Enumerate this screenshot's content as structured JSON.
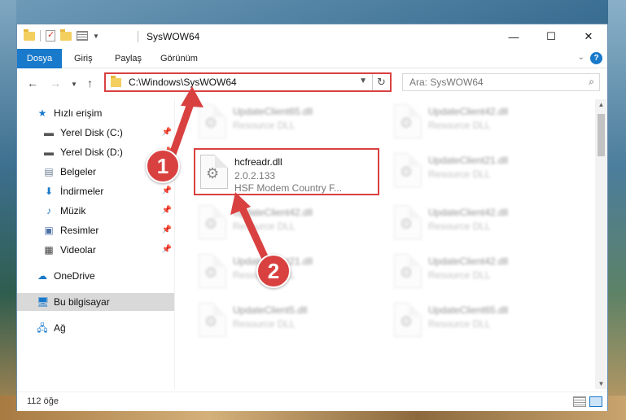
{
  "window": {
    "title": "SysWOW64",
    "buttons": {
      "minimize": "—",
      "maximize": "☐",
      "close": "✕"
    }
  },
  "ribbon": {
    "tabs": [
      "Dosya",
      "Giriş",
      "Paylaş",
      "Görünüm"
    ],
    "help": "?"
  },
  "nav": {
    "address": "C:\\Windows\\SysWOW64",
    "search_placeholder": "Ara: SysWOW64"
  },
  "sidebar": {
    "items": [
      {
        "label": "Hızlı erişim",
        "icon": "star-icon",
        "pinned": false
      },
      {
        "label": "Yerel Disk (C:)",
        "icon": "drive-icon",
        "pinned": true
      },
      {
        "label": "Yerel Disk (D:)",
        "icon": "drive-icon",
        "pinned": true
      },
      {
        "label": "Belgeler",
        "icon": "documents-icon",
        "pinned": true
      },
      {
        "label": "İndirmeler",
        "icon": "download-icon",
        "pinned": true
      },
      {
        "label": "Müzik",
        "icon": "music-icon",
        "pinned": true
      },
      {
        "label": "Resimler",
        "icon": "pictures-icon",
        "pinned": true
      },
      {
        "label": "Videolar",
        "icon": "video-icon",
        "pinned": true
      },
      {
        "label": "OneDrive",
        "icon": "cloud-icon",
        "pinned": false
      },
      {
        "label": "Bu bilgisayar",
        "icon": "computer-icon",
        "pinned": false
      },
      {
        "label": "Ağ",
        "icon": "network-icon",
        "pinned": false
      }
    ]
  },
  "files": {
    "highlighted": {
      "name": "hcfreadr.dll",
      "version": "2.0.2.133",
      "description": "HSF Modem Country F..."
    },
    "left_column": [
      {
        "name": "UpdateClient65.dll",
        "desc": "Resource DLL"
      },
      {
        "name": "UpdateClient42.dll",
        "desc": "Resource DLL"
      },
      {
        "name": "UpdateClient21.dll",
        "desc": "Resource DLL"
      },
      {
        "name": "UpdateClient5.dll",
        "desc": "Resource DLL"
      }
    ],
    "right_column": [
      {
        "name": "UpdateClient42.dll",
        "desc": "Resource DLL"
      },
      {
        "name": "UpdateClient21.dll",
        "desc": "Resource DLL"
      },
      {
        "name": "UpdateClient42.dll",
        "desc": "Resource DLL"
      },
      {
        "name": "UpdateClient42.dll",
        "desc": "Resource DLL"
      },
      {
        "name": "UpdateClient65.dll",
        "desc": "Resource DLL"
      }
    ]
  },
  "status": {
    "count": "112 öğe"
  },
  "annotations": {
    "step1": "1",
    "step2": "2",
    "color": "#d94141"
  }
}
